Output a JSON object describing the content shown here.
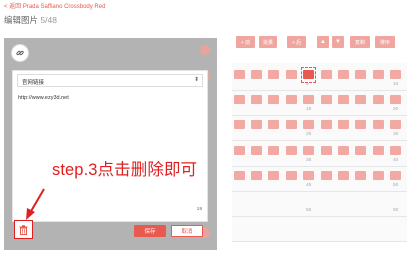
{
  "header": {
    "back_label": "< 返回 Prada Saffiano Crossbody Red",
    "title": "编辑图片",
    "count": "5/48"
  },
  "editor": {
    "link_type": "官网链接",
    "url_value": "http://www.ezy3d.net",
    "char_count": "19",
    "save_label": "保存",
    "cancel_label": "取消"
  },
  "annotation": {
    "text": "step.3点击删除即可"
  },
  "toolbar": {
    "add_before": "+ 前",
    "batch": "批量",
    "add_after": "+ 后",
    "icon_1": "▲",
    "icon_2": "▼",
    "copy": "复制",
    "sort": "排序"
  },
  "grid": {
    "numbers": [
      "5",
      "10",
      "15",
      "20",
      "25",
      "30",
      "35",
      "40",
      "45",
      "50",
      "55",
      "60"
    ]
  },
  "colors": {
    "accent": "#e85a4f",
    "annotation": "#e02020"
  }
}
